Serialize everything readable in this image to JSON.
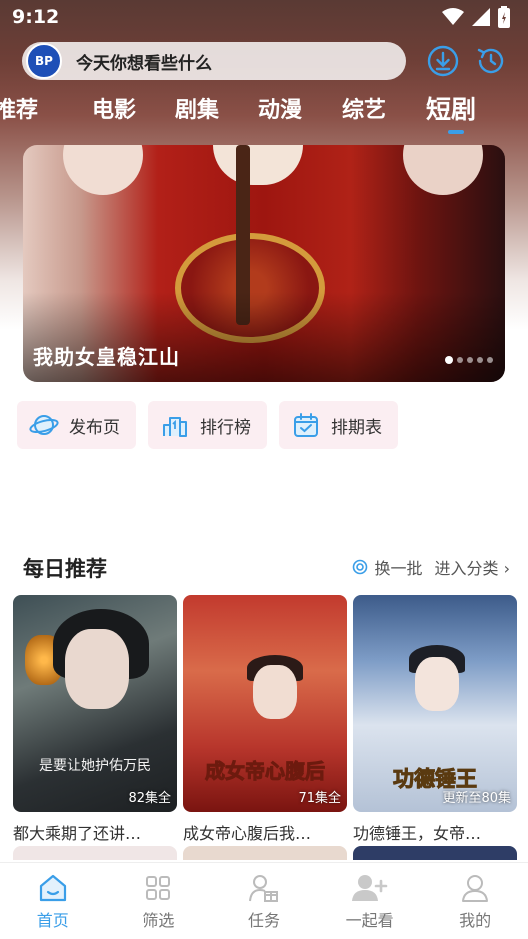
{
  "status_bar": {
    "time": "9:12"
  },
  "search": {
    "placeholder": "今天你想看些什么",
    "logo_text": "BP"
  },
  "tabs": [
    {
      "label": "推荐"
    },
    {
      "label": "电影"
    },
    {
      "label": "剧集"
    },
    {
      "label": "动漫"
    },
    {
      "label": "综艺"
    },
    {
      "label": "短剧",
      "active": true
    }
  ],
  "banner": {
    "title": "我助女皇稳江山",
    "slide_count": 5,
    "active_slide": 1
  },
  "quick_actions": [
    {
      "label": "发布页",
      "icon": "planet-icon"
    },
    {
      "label": "排行榜",
      "icon": "ranking-icon"
    },
    {
      "label": "排期表",
      "icon": "calendar-icon"
    }
  ],
  "section": {
    "title": "每日推荐",
    "refresh_label": "换一批",
    "more_label": "进入分类 ›"
  },
  "cards": [
    {
      "title": "都大乘期了还讲…",
      "badge": "82集全",
      "caption": "是要让她护佑万民"
    },
    {
      "title": "成女帝心腹后我…",
      "badge": "71集全",
      "caption": "成女帝心腹后"
    },
    {
      "title": "功德锤王，女帝…",
      "badge": "更新至80集",
      "caption": "功德锤王"
    }
  ],
  "bottom_nav": [
    {
      "label": "首页",
      "icon": "home-icon",
      "active": true
    },
    {
      "label": "筛选",
      "icon": "grid-icon"
    },
    {
      "label": "任务",
      "icon": "gift-user-icon"
    },
    {
      "label": "一起看",
      "icon": "add-user-icon"
    },
    {
      "label": "我的",
      "icon": "profile-icon"
    }
  ],
  "colors": {
    "accent": "#3a9ee8",
    "quick_bg": "#fbeef2"
  }
}
